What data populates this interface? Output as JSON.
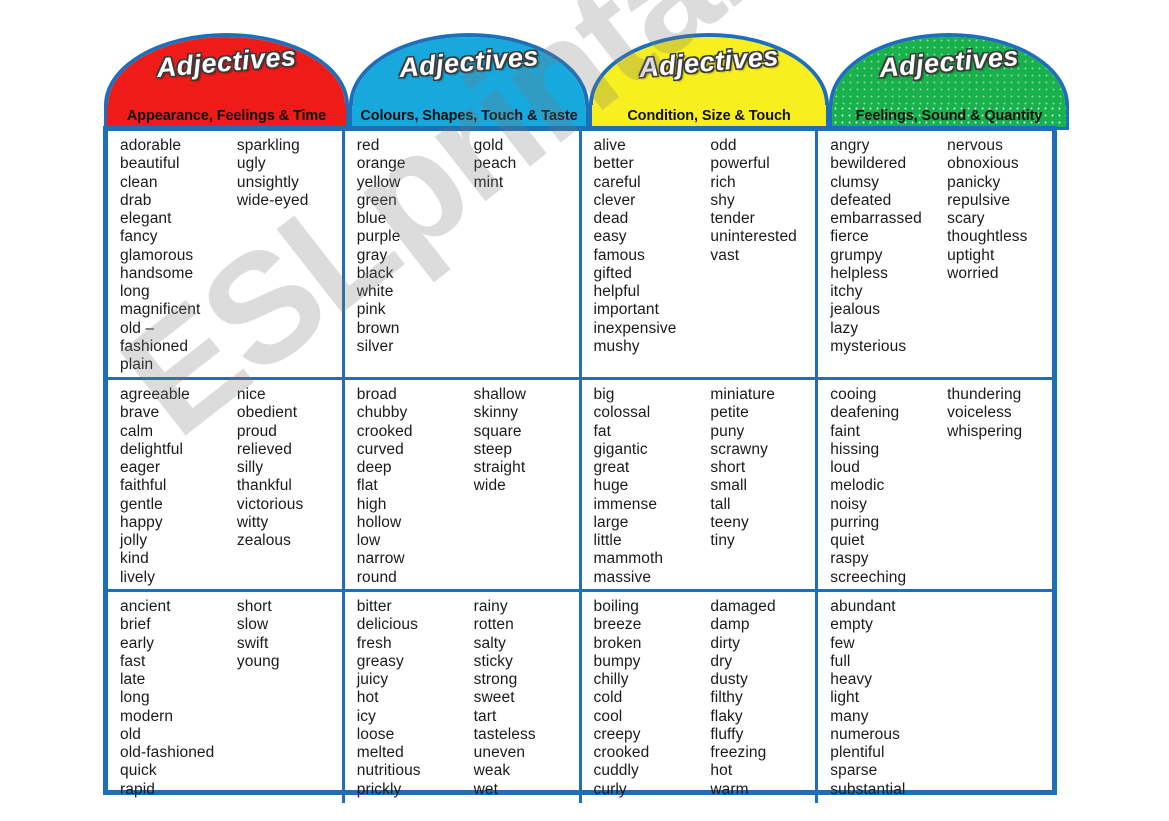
{
  "watermark": {
    "text": "ESLprintables.com"
  },
  "frame": {
    "border_color": "#1d6fba"
  },
  "columns": [
    {
      "id": "appearance",
      "title": "Adjectives",
      "subtitle": "Appearance, Feelings & Time",
      "header_color": "#ee1b18",
      "border_color": "#1d6fba",
      "groups": [
        {
          "left": [
            "adorable",
            "beautiful",
            "clean",
            "drab",
            "elegant",
            "fancy",
            "glamorous",
            "handsome",
            "long",
            "magnificent",
            "old –",
            "fashioned",
            "plain"
          ],
          "right": [
            "sparkling",
            "ugly",
            "unsightly",
            "wide-eyed"
          ]
        },
        {
          "left": [
            "agreeable",
            "brave",
            "calm",
            "delightful",
            "eager",
            "faithful",
            "gentle",
            "happy",
            "jolly",
            "kind",
            "lively"
          ],
          "right": [
            "nice",
            "obedient",
            "proud",
            "relieved",
            "silly",
            "thankful",
            "victorious",
            "witty",
            "zealous"
          ]
        },
        {
          "left": [
            "ancient",
            "brief",
            "early",
            "fast",
            "late",
            "long",
            "modern",
            "old",
            "old-fashioned",
            "quick",
            "rapid"
          ],
          "right": [
            "short",
            "slow",
            "swift",
            "young"
          ]
        }
      ]
    },
    {
      "id": "colours",
      "title": "Adjectives",
      "subtitle": "Colours, Shapes, Touch & Taste",
      "header_color": "#17a8dd",
      "border_color": "#1d6fba",
      "groups": [
        {
          "left": [
            "red",
            "orange",
            "yellow",
            "green",
            "blue",
            "purple",
            "gray",
            "black",
            "white",
            "pink",
            "brown",
            "silver"
          ],
          "right": [
            "gold",
            "peach",
            "mint"
          ]
        },
        {
          "left": [
            "broad",
            "chubby",
            "crooked",
            "curved",
            "deep",
            "flat",
            "high",
            "hollow",
            "low",
            "narrow",
            "round"
          ],
          "right": [
            "shallow",
            "skinny",
            "square",
            "steep",
            "straight",
            "wide"
          ]
        },
        {
          "left": [
            "bitter",
            "delicious",
            "fresh",
            "greasy",
            "juicy",
            "hot",
            "icy",
            "loose",
            "melted",
            "nutritious",
            "prickly"
          ],
          "right": [
            "rainy",
            "rotten",
            "salty",
            "sticky",
            "strong",
            "sweet",
            "tart",
            "tasteless",
            "uneven",
            "weak",
            "wet"
          ]
        }
      ]
    },
    {
      "id": "condition",
      "title": "Adjectives",
      "subtitle": "Condition, Size & Touch",
      "header_color": "#f7ef1f",
      "border_color": "#1d6fba",
      "groups": [
        {
          "left": [
            "alive",
            "better",
            "careful",
            "clever",
            "dead",
            "easy",
            "famous",
            "gifted",
            "helpful",
            "important",
            "inexpensive",
            "mushy"
          ],
          "right": [
            "odd",
            "powerful",
            "rich",
            "shy",
            "tender",
            "uninterested",
            "vast"
          ]
        },
        {
          "left": [
            "big",
            "colossal",
            "fat",
            "gigantic",
            "great",
            "huge",
            "immense",
            "large",
            "little",
            "mammoth",
            "massive"
          ],
          "right": [
            "miniature",
            "petite",
            "puny",
            "scrawny",
            "short",
            "small",
            "tall",
            "teeny",
            "tiny"
          ]
        },
        {
          "left": [
            "boiling",
            "breeze",
            "broken",
            "bumpy",
            "chilly",
            "cold",
            "cool",
            "creepy",
            "crooked",
            "cuddly",
            "curly"
          ],
          "right": [
            "damaged",
            "damp",
            "dirty",
            "dry",
            "dusty",
            "filthy",
            "flaky",
            "fluffy",
            "freezing",
            "hot",
            "warm"
          ]
        }
      ]
    },
    {
      "id": "feelings",
      "title": "Adjectives",
      "subtitle": "Feelings, Sound & Quantity",
      "header_color": "#18b14b",
      "border_color": "#1d6fba",
      "groups": [
        {
          "left": [
            "angry",
            "bewildered",
            "clumsy",
            "defeated",
            "embarrassed",
            "fierce",
            "grumpy",
            "helpless",
            "itchy",
            "jealous",
            "lazy",
            "mysterious"
          ],
          "right": [
            "nervous",
            "obnoxious",
            "panicky",
            "repulsive",
            "scary",
            "thoughtless",
            "uptight",
            "worried"
          ]
        },
        {
          "left": [
            "cooing",
            "deafening",
            "faint",
            "hissing",
            "loud",
            "melodic",
            "noisy",
            "purring",
            "quiet",
            "raspy",
            "screeching"
          ],
          "right": [
            "thundering",
            "voiceless",
            "whispering"
          ]
        },
        {
          "left": [
            "abundant",
            "empty",
            "few",
            "full",
            "heavy",
            "light",
            "many",
            "numerous",
            "plentiful",
            "sparse",
            "substantial"
          ],
          "right": []
        }
      ]
    }
  ]
}
